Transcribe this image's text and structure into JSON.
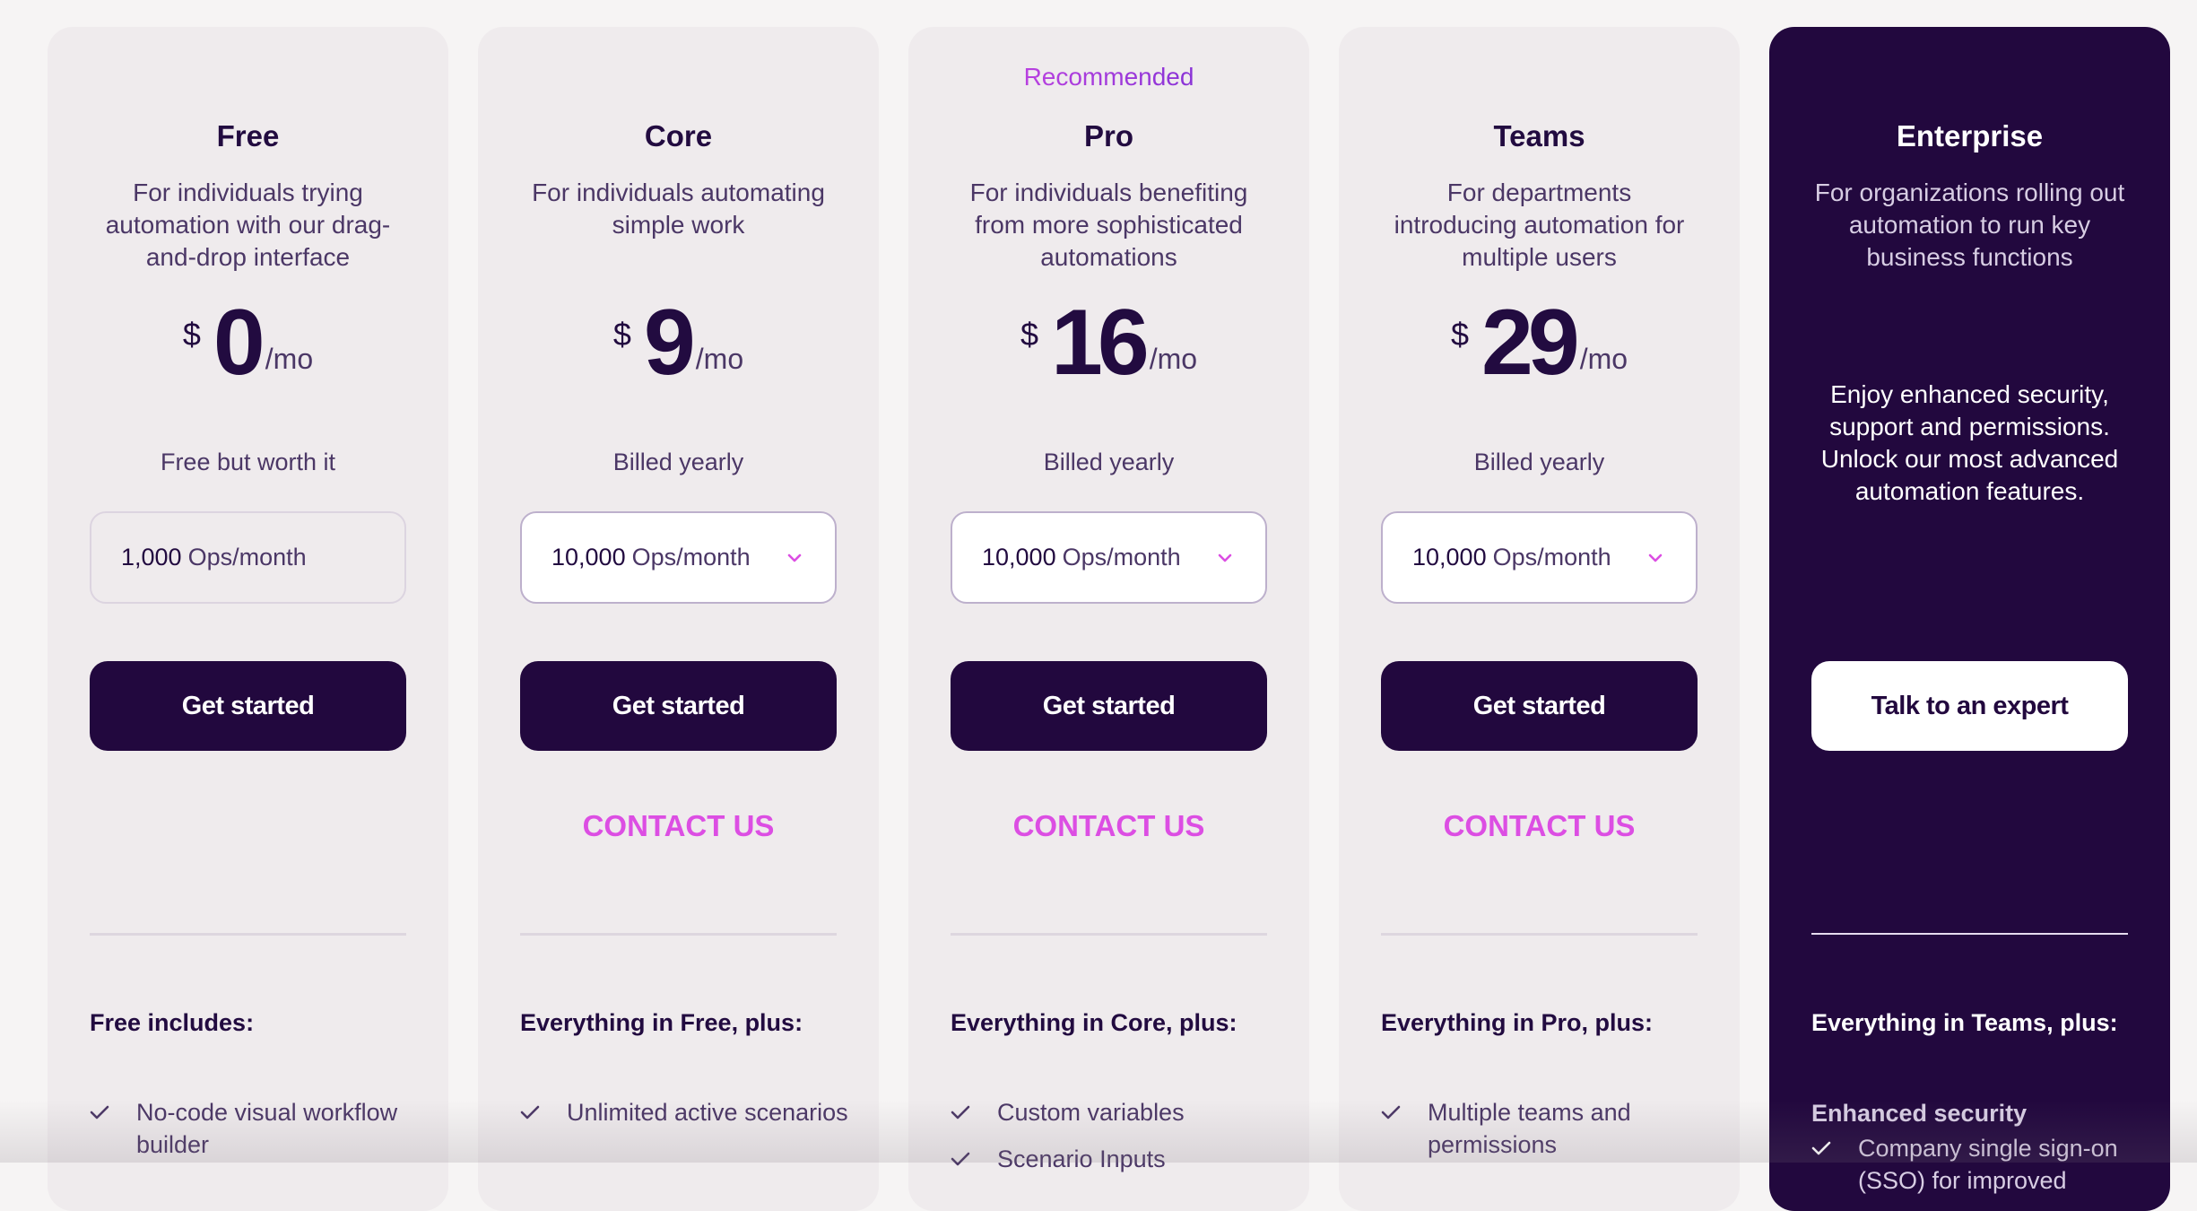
{
  "colors": {
    "brand_dark": "#22083e",
    "card_bg": "#efebed",
    "accent_pink": "#dc4ee3",
    "body_text": "#4b3766"
  },
  "plans": [
    {
      "name": "Free",
      "description": "For individuals trying automation with our drag-and-drop interface",
      "currency": "$",
      "price": "0",
      "period": "/mo",
      "billing_note": "Free but worth it",
      "ops_value": "1,000",
      "ops_unit": "Ops/month",
      "cta_label": "Get started",
      "features_heading": "Free includes:",
      "features": [
        "No-code visual workflow builder"
      ]
    },
    {
      "name": "Core",
      "description": "For individuals automating simple work",
      "currency": "$",
      "price": "9",
      "period": "/mo",
      "billing_note": "Billed yearly",
      "ops_value": "10,000",
      "ops_unit": "Ops/month",
      "cta_label": "Get started",
      "contact_label": "CONTACT US",
      "features_heading": "Everything in Free, plus:",
      "features": [
        "Unlimited active scenarios"
      ]
    },
    {
      "badge": "Recommended",
      "name": "Pro",
      "description": "For individuals benefiting from more sophisticated automations",
      "currency": "$",
      "price": "16",
      "period": "/mo",
      "billing_note": "Billed yearly",
      "ops_value": "10,000",
      "ops_unit": "Ops/month",
      "cta_label": "Get started",
      "contact_label": "CONTACT US",
      "features_heading": "Everything in Core, plus:",
      "features": [
        "Custom variables",
        "Scenario Inputs"
      ]
    },
    {
      "name": "Teams",
      "description": "For departments introducing automation for multiple users",
      "currency": "$",
      "price": "29",
      "period": "/mo",
      "billing_note": "Billed yearly",
      "ops_value": "10,000",
      "ops_unit": "Ops/month",
      "cta_label": "Get started",
      "contact_label": "CONTACT US",
      "features_heading": "Everything in Pro, plus:",
      "features": [
        "Multiple teams and permissions"
      ]
    },
    {
      "name": "Enterprise",
      "description": "For organizations rolling out automation to run key business functions",
      "pitch": "Enjoy enhanced security, support and permissions. Unlock our most advanced automation features.",
      "cta_label": "Talk to an expert",
      "features_heading": "Everything in Teams, plus:",
      "features_subheading": "Enhanced security",
      "features": [
        "Company single sign-on (SSO) for improved"
      ]
    }
  ]
}
